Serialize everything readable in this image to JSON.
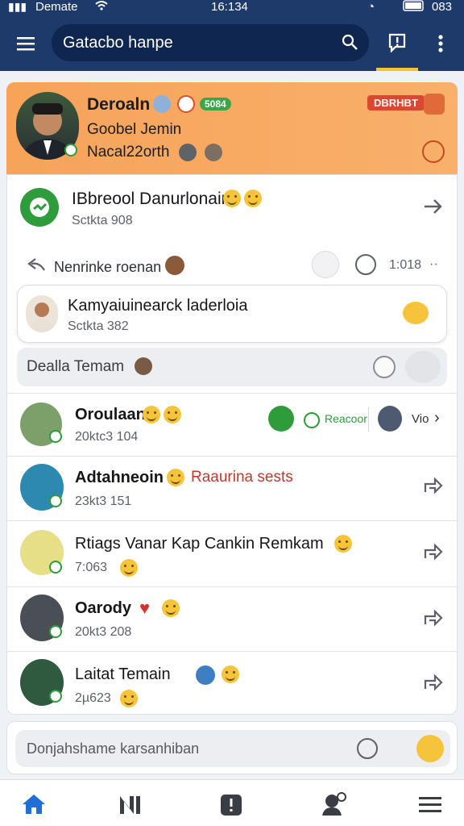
{
  "status_bar": {
    "carrier": "Demate",
    "time": "16:134",
    "battery": "083"
  },
  "header": {
    "search_text": "Gatacbo hanpe"
  },
  "profile_card": {
    "name": "Deroaln",
    "tag": "5084",
    "badge": "DBRHBT",
    "subtitle": "Goobel Jemin",
    "meta": "Nacal22orth",
    "accent": "#f7a35a"
  },
  "group_card": {
    "title": "IBbreool Danurlonaira",
    "sub": "Sctkta 908",
    "forward_text": "Nenrinke roenan",
    "time": "1:018"
  },
  "highlight_item": {
    "name": "Kamyaiuinearck laderloia",
    "sub": "Sctkta 382"
  },
  "team_bar": {
    "label": "Dealla Temam"
  },
  "list": [
    {
      "name": "Oroulaan",
      "sub": "20ktc3 104",
      "extra": "Reacoor",
      "extra2": "Vio"
    },
    {
      "name": "Adtahneoin",
      "sub": "23kt3 151",
      "highlight": "Raaurina sests"
    },
    {
      "name": "Rtiags Vanar Kap Cankin Remkam",
      "sub": "7:063"
    },
    {
      "name": "Oarody",
      "sub": "20kt3 208"
    },
    {
      "name": "Laitat Temain",
      "sub": "2µ623"
    }
  ],
  "composer": {
    "placeholder": "Donjahshame karsanhiban"
  },
  "colors": {
    "appbar": "#1d3a6b",
    "green": "#2e9c3a",
    "orange": "#f7a35a"
  }
}
